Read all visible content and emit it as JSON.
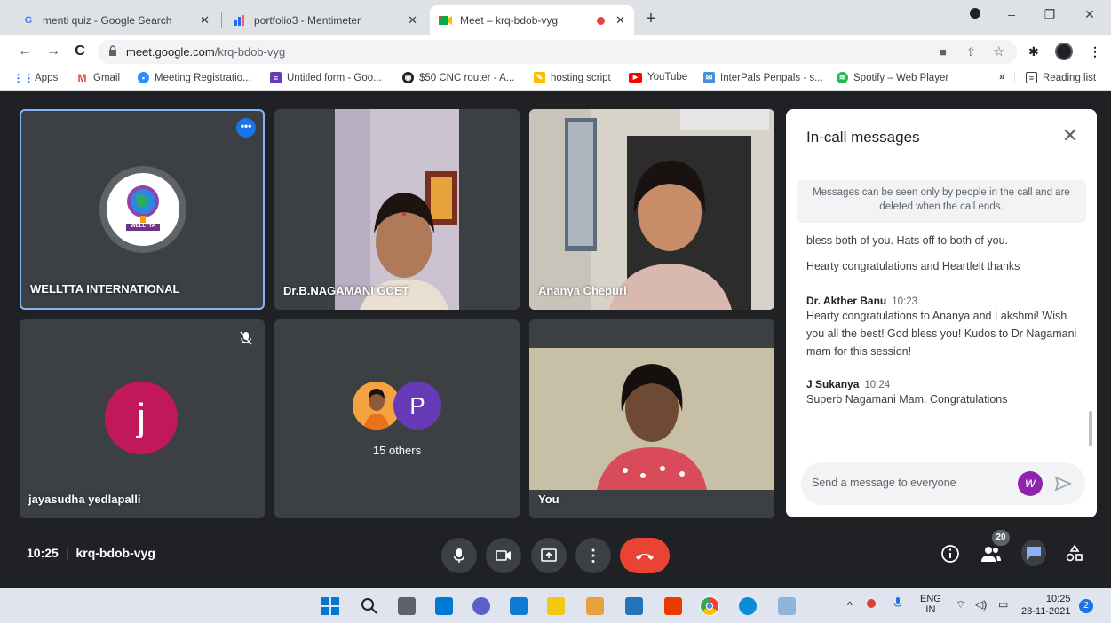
{
  "browser": {
    "tabs": [
      {
        "title": "menti quiz - Google Search",
        "close": "✕"
      },
      {
        "title": "portfolio3 - Mentimeter",
        "close": "✕"
      },
      {
        "title": "Meet – krq-bdob-vyg",
        "close": "✕"
      }
    ],
    "new_tab": "+",
    "url_host": "meet.google.com",
    "url_path": "/krq-bdob-vyg",
    "bookmarks": [
      "Apps",
      "Gmail",
      "Meeting Registratio...",
      "Untitled form - Goo...",
      "$50 CNC router - A...",
      "hosting script",
      "YouTube",
      "InterPals Penpals - s...",
      "Spotify – Web Player"
    ],
    "bookmarks_more": "»",
    "reading_list": "Reading list"
  },
  "tiles": {
    "welltta": {
      "name": "WELLTTA INTERNATIONAL",
      "logo_text": "WELLTTA"
    },
    "nagamani": {
      "name": "Dr.B.NAGAMANI GCET"
    },
    "ananya": {
      "name": "Ananya Chepuri"
    },
    "jayasudha": {
      "name": "jayasudha yedlapalli",
      "initial": "j"
    },
    "others": {
      "label": "15 others",
      "avatar_letter": "P"
    },
    "you": {
      "name": "You"
    }
  },
  "chat": {
    "title": "In-call messages",
    "notice": "Messages can be seen only by people in the call and are deleted when the call ends.",
    "messages": [
      {
        "text_1": "bless both of you. Hats off to both of you.",
        "text_2": "Hearty congratulations and Heartfelt thanks"
      },
      {
        "sender": "Dr. Akther Banu",
        "time": "10:23",
        "text": "Hearty congratulations to Ananya and Lakshmi! Wish you all the best! God bless you! Kudos to Dr Nagamani mam for this session!"
      },
      {
        "sender": "J Sukanya",
        "time": "10:24",
        "text": "Superb Nagamani Mam. Congratulations"
      }
    ],
    "input_placeholder": "Send a message to everyone"
  },
  "callbar": {
    "time": "10:25",
    "meeting_code": "krq-bdob-vyg",
    "people_count": "20"
  },
  "taskbar": {
    "lang_1": "ENG",
    "lang_2": "IN",
    "clock_time": "10:25",
    "clock_date": "28-11-2021",
    "notification_count": "2"
  },
  "colors": {
    "meet_bg": "#202124",
    "tile_bg": "#3c4043",
    "hangup": "#ea4335",
    "accent": "#1a73e8",
    "avatar_j": "#c2185b",
    "avatar_p": "#673ab7"
  }
}
